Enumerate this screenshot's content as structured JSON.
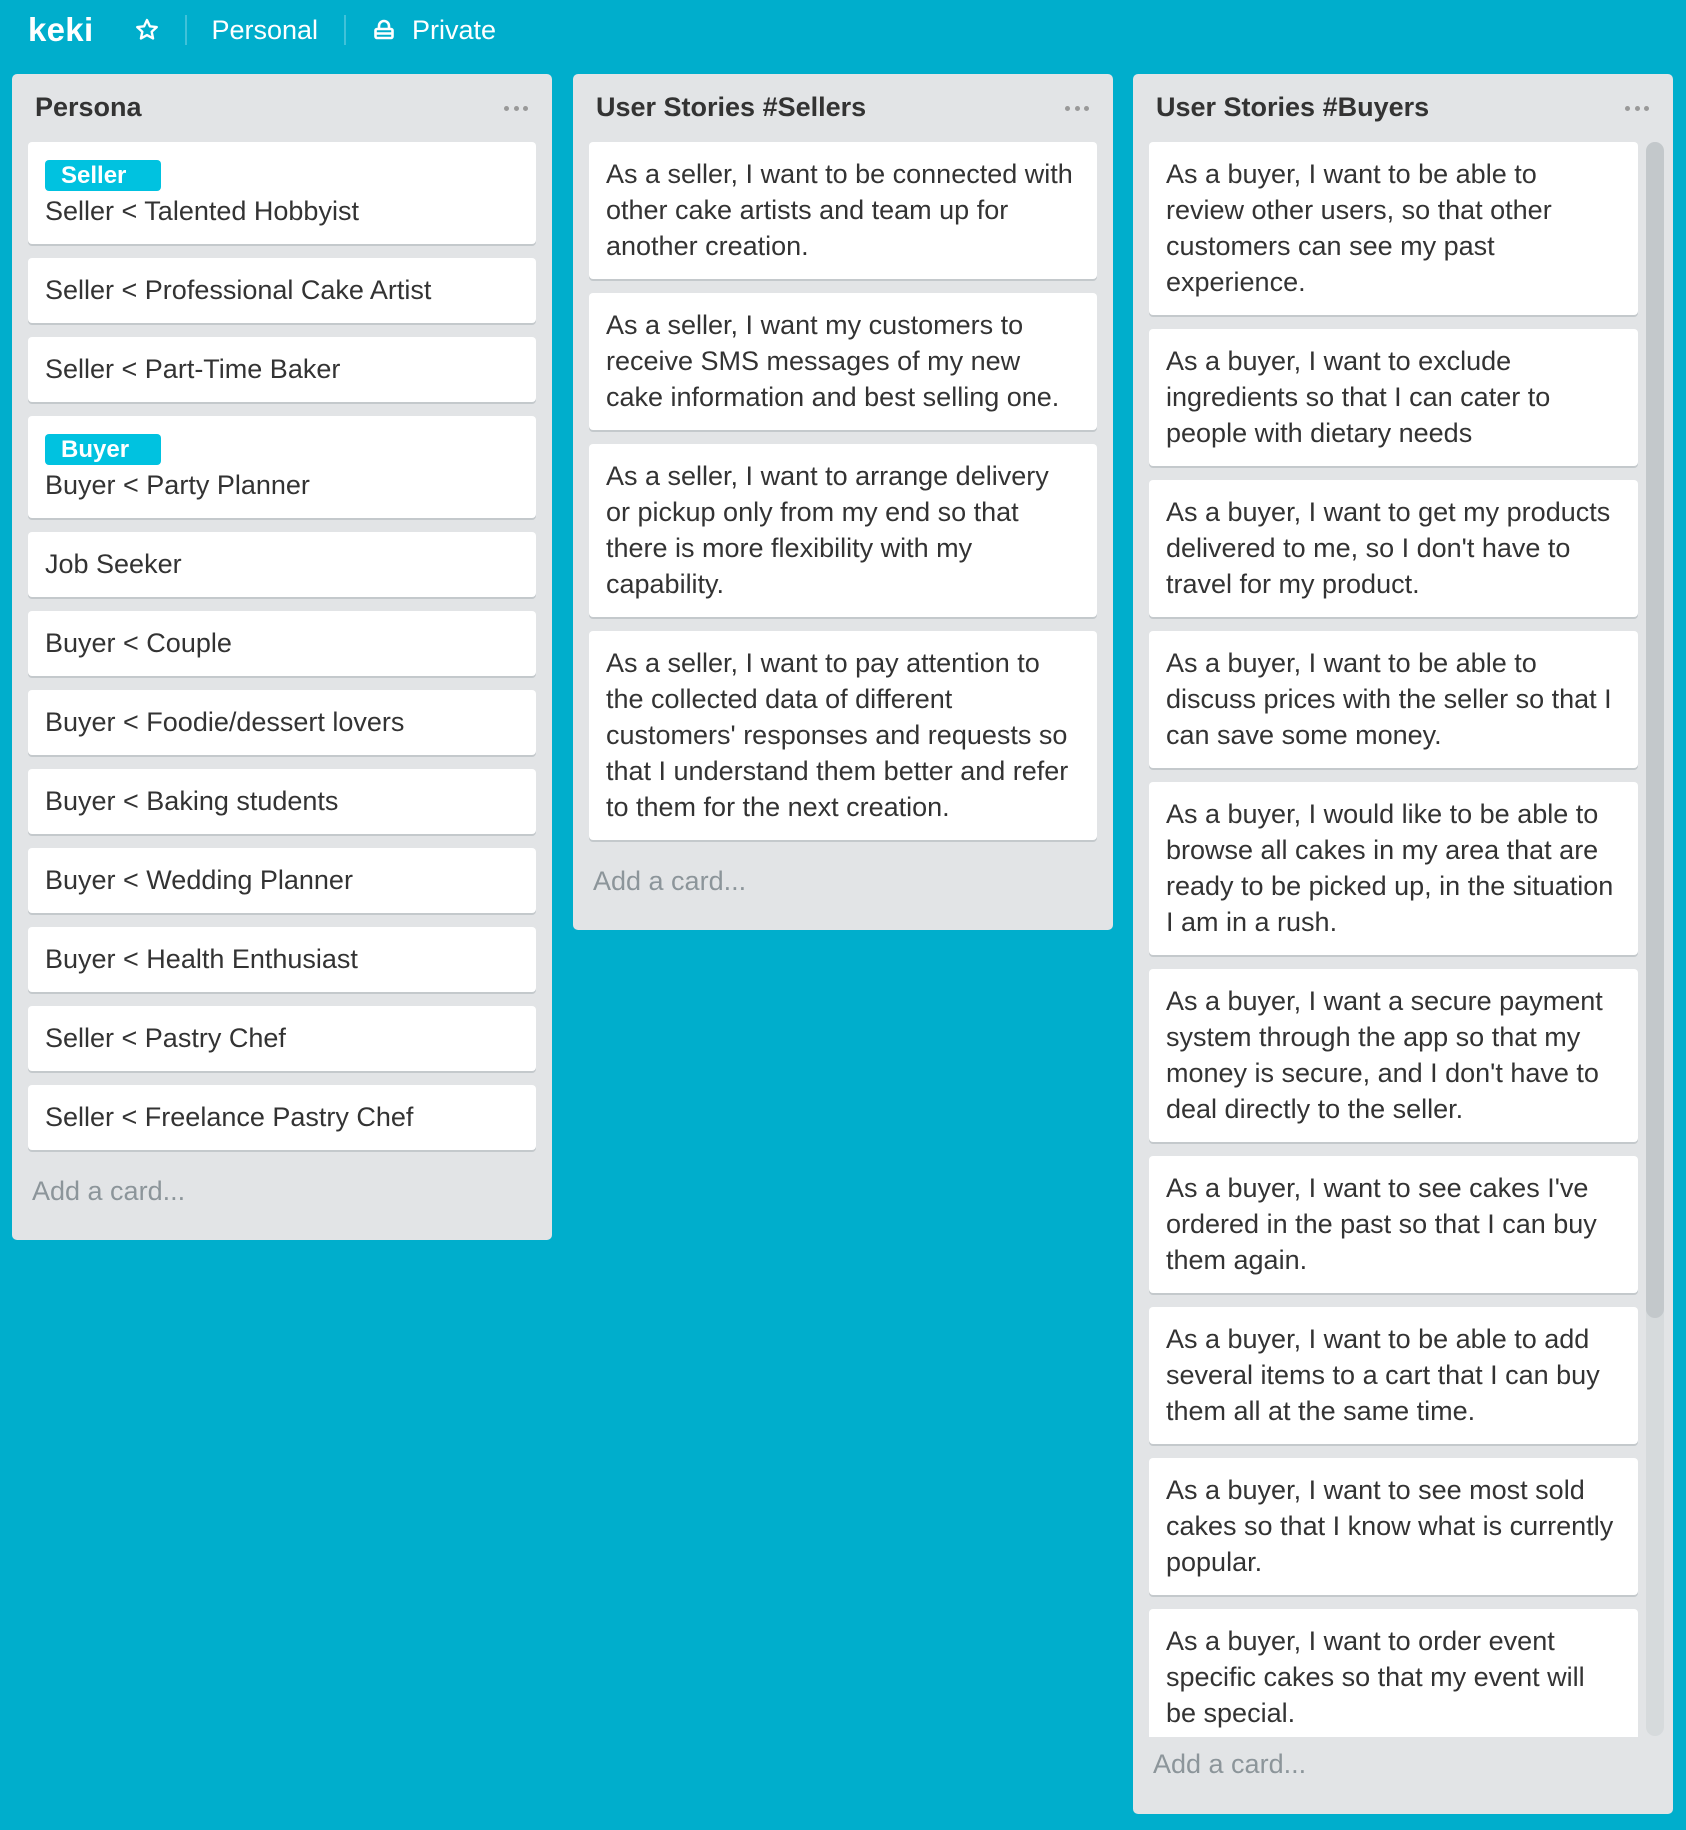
{
  "header": {
    "board_title": "keki",
    "star_icon": "star-outline-icon",
    "team": "Personal",
    "visibility_icon": "lock-icon",
    "visibility": "Private"
  },
  "colors": {
    "background": "#00AECC",
    "list_bg": "#E2E4E6",
    "label_sky": "#00C2E0",
    "card_bg": "#FFFFFF"
  },
  "lists": [
    {
      "title": "Persona",
      "menu_icon": "ellipsis-icon",
      "add_card": "Add a card...",
      "cards": [
        {
          "label": "Seller",
          "text": "Seller < Talented Hobbyist"
        },
        {
          "text": "Seller < Professional Cake Artist"
        },
        {
          "text": "Seller < Part-Time Baker"
        },
        {
          "label": "Buyer",
          "text": "Buyer < Party Planner"
        },
        {
          "text": "Job Seeker"
        },
        {
          "text": "Buyer < Couple"
        },
        {
          "text": "Buyer < Foodie/dessert lovers"
        },
        {
          "text": "Buyer < Baking students"
        },
        {
          "text": "Buyer < Wedding Planner"
        },
        {
          "text": "Buyer < Health Enthusiast"
        },
        {
          "text": "Seller < Pastry Chef"
        },
        {
          "text": "Seller < Freelance Pastry Chef"
        }
      ]
    },
    {
      "title": "User Stories #Sellers",
      "menu_icon": "ellipsis-icon",
      "add_card": "Add a card...",
      "cards": [
        {
          "text": "As a seller, I want to be connected with other cake artists and team up for another creation."
        },
        {
          "text": "As a seller, I want my customers to receive SMS messages of my new cake information and best selling one."
        },
        {
          "text": "As a seller, I want to arrange delivery or pickup only from my end so that there is more flexibility with my capability."
        },
        {
          "text": "As a seller, I want to pay attention to the collected data of different customers' responses and requests so that I understand them better and refer to them for the next creation."
        }
      ]
    },
    {
      "title": "User Stories #Buyers",
      "menu_icon": "ellipsis-icon",
      "add_card": "Add a card...",
      "cards": [
        {
          "text": "As a buyer, I want to be able to review other users, so that other customers can see my past experience."
        },
        {
          "text": "As a buyer, I want to exclude ingredients so that I can cater to people with dietary needs"
        },
        {
          "text": "As a buyer, I want to get my products delivered to me, so I don't have to travel for my product."
        },
        {
          "text": "As a buyer, I want to be able to discuss prices with the seller so that I can save some money."
        },
        {
          "text": "As a buyer, I would like to be able to browse all cakes in my area that are ready to be picked up, in the situation I am in a rush."
        },
        {
          "text": "As a buyer, I want a secure payment system through the app so that my money is secure, and I don't have to deal directly to the seller."
        },
        {
          "text": "As a buyer, I want to see cakes I've ordered in the past so that I can buy them again."
        },
        {
          "text": "As a buyer, I want to be able to add several items to a cart that I can buy them all at the same time."
        },
        {
          "text": "As a buyer, I want to see most sold cakes so that I know what is currently popular."
        },
        {
          "text": "As a buyer, I want to order event specific cakes so that my event will be special."
        }
      ]
    }
  ]
}
